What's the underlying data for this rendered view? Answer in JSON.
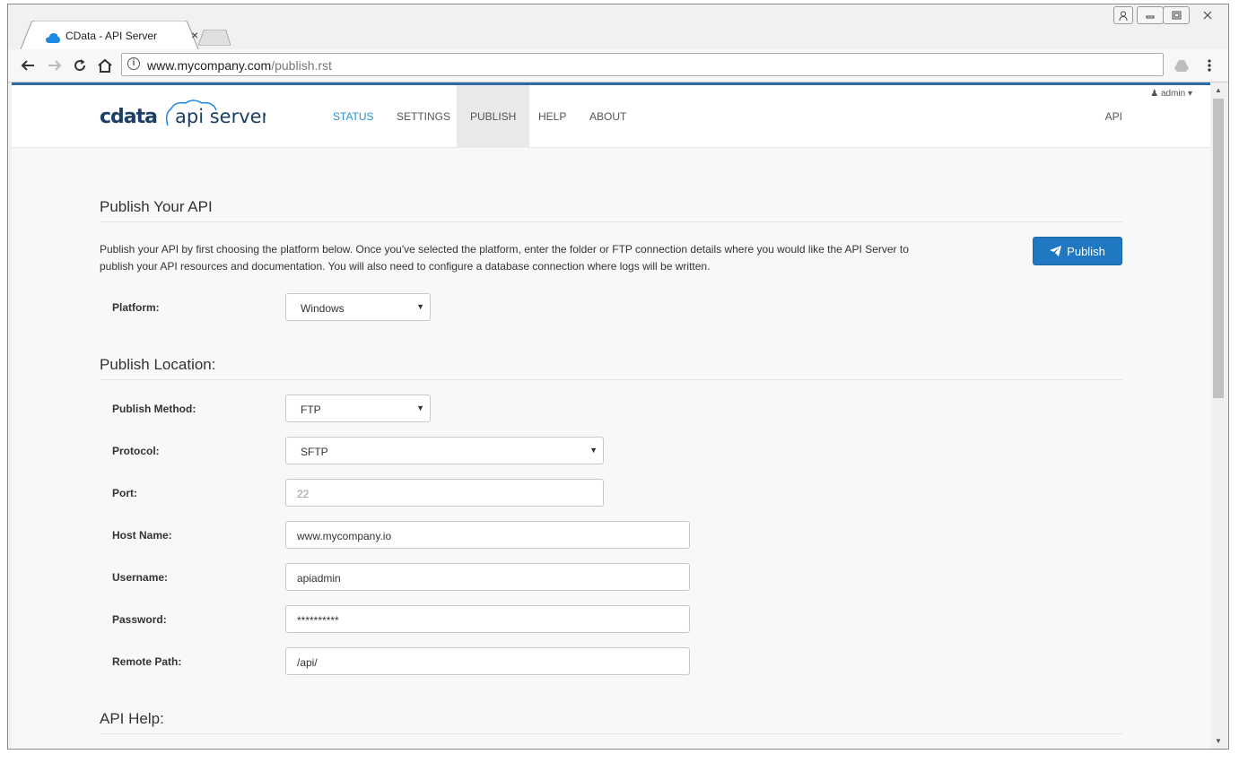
{
  "browser": {
    "tab_title": "CData - API Server",
    "tab_close": "×",
    "url_host": "www.mycompany.com",
    "url_path": "/publish.rst"
  },
  "app": {
    "logo_brand": "cdata",
    "logo_product": "api server",
    "nav": [
      {
        "label": "STATUS"
      },
      {
        "label": "SETTINGS"
      },
      {
        "label": "PUBLISH"
      },
      {
        "label": "HELP"
      },
      {
        "label": "ABOUT"
      }
    ],
    "api_link": "API",
    "user_menu": "admin",
    "accent_color": "#2a8fd1",
    "brand_bar_color": "#2c6ca3"
  },
  "publish": {
    "heading": "Publish Your API",
    "description": "Publish your API by first choosing the platform below. Once you've selected the platform, enter the folder or FTP connection details where you would like the API Server to publish your API resources and documentation. You will also need to configure a database connection where logs will be written.",
    "publish_button": "Publish",
    "platform_label": "Platform:",
    "platform_value": "Windows"
  },
  "location": {
    "heading": "Publish Location:",
    "method_label": "Publish Method:",
    "method_value": "FTP",
    "protocol_label": "Protocol:",
    "protocol_value": "SFTP",
    "port_label": "Port:",
    "port_value": "22",
    "host_label": "Host Name:",
    "host_value": "www.mycompany.io",
    "username_label": "Username:",
    "username_value": "apiadmin",
    "password_label": "Password:",
    "password_value": "**********",
    "remote_label": "Remote Path:",
    "remote_value": "/api/"
  },
  "help": {
    "heading": "API Help:"
  }
}
